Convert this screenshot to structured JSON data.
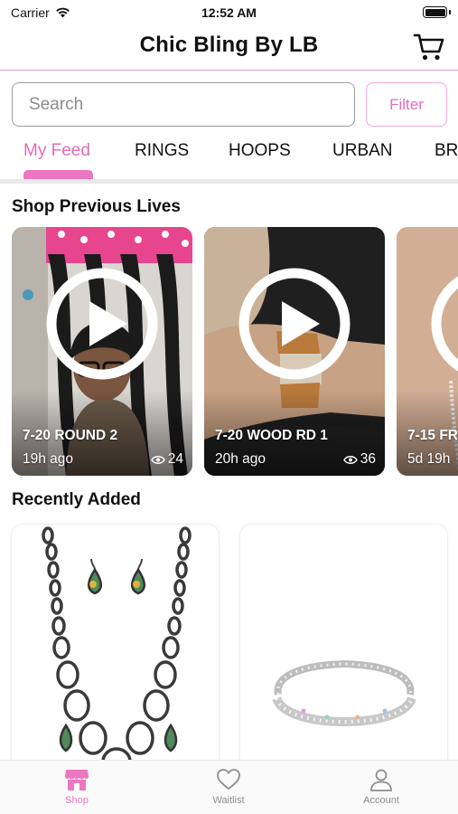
{
  "status_bar": {
    "carrier": "Carrier",
    "time": "12:52 AM"
  },
  "header": {
    "title": "Chic Bling By LB",
    "cart_icon": "cart-icon"
  },
  "search": {
    "placeholder": "Search",
    "value": ""
  },
  "filter": {
    "label": "Filter"
  },
  "tabs": [
    {
      "label": "My Feed",
      "active": true
    },
    {
      "label": "RINGS",
      "active": false
    },
    {
      "label": "HOOPS",
      "active": false
    },
    {
      "label": "URBAN",
      "active": false
    },
    {
      "label": "BRA",
      "active": false
    }
  ],
  "sections": {
    "previous_lives": "Shop Previous Lives",
    "recently_added": "Recently Added"
  },
  "lives": [
    {
      "title": "7-20 ROUND 2",
      "time": "19h ago",
      "views": "24"
    },
    {
      "title": "7-20 WOOD RD 1",
      "time": "20h ago",
      "views": "36"
    },
    {
      "title": "7-15 FR",
      "time": "5d 19h",
      "views": ""
    }
  ],
  "bottom_nav": [
    {
      "label": "Shop",
      "icon": "shop-icon",
      "active": true
    },
    {
      "label": "Waitlist",
      "icon": "heart-icon",
      "active": false
    },
    {
      "label": "Account",
      "icon": "person-icon",
      "active": false
    }
  ],
  "colors": {
    "accent": "#ec77bf",
    "accent_text": "#e46cb8",
    "header_line": "#e39bc9"
  }
}
